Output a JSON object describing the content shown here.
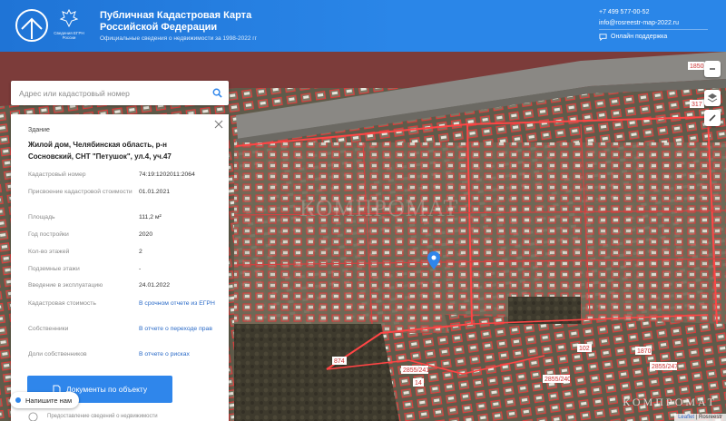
{
  "header": {
    "title": "Публичная Кадастровая Карта Российской Федерации",
    "subtitle": "Официальные сведения о недвижимости за 1998-2022 гг",
    "emblem_caption": "Сведения ЕГРН России",
    "phone": "+7 499 577-00-52",
    "email": "info@rosreestr-map-2022.ru",
    "support": "Онлайн поддержка"
  },
  "search": {
    "placeholder": "Адрес или кадастровый номер"
  },
  "object": {
    "type": "Здание",
    "address": "Жилой дом, Челябинская область, р-н Сосновский, СНТ \"Петушок\", ул.4, уч.47",
    "rows": [
      {
        "label": "Кадастровый номер",
        "value": "74:19:1202011:2064"
      },
      {
        "label": "Присвоение кадастровой стоимости",
        "value": "01.01.2021"
      },
      {
        "label": "Площадь",
        "value": "111,2 м²"
      },
      {
        "label": "Год постройки",
        "value": "2020"
      },
      {
        "label": "Кол-во этажей",
        "value": "2"
      },
      {
        "label": "Подземные этажи",
        "value": "-"
      },
      {
        "label": "Введение в эксплуатацию",
        "value": "24.01.2022"
      },
      {
        "label": "Кадастровая стоимость",
        "value": "В срочном отчете из ЕГРН"
      },
      {
        "label": "Собственники",
        "value": "В отчете о переходе прав"
      },
      {
        "label": "Доли собственников",
        "value": "В отчете о рисках"
      }
    ],
    "documents_button": "Документы по объекту",
    "footer_note": "Предоставление сведений о недвижимости"
  },
  "chat": {
    "label": "Напишите нам"
  },
  "map": {
    "watermark_center": "КОМПРОМАТ",
    "watermark_corner": "КОМПРОМАТ",
    "attribution_link": "Leaflet",
    "attribution_source": "Rosreestr",
    "parcel_labels": [
      "1850",
      "2855/241",
      "874",
      "2855/247",
      "1870",
      "317",
      "102",
      "2855/240",
      "14"
    ]
  },
  "colors": {
    "accent": "#2f86eb",
    "header": "#2a86e8",
    "parcel_line": "#d93636",
    "link": "#2a6ac7"
  }
}
